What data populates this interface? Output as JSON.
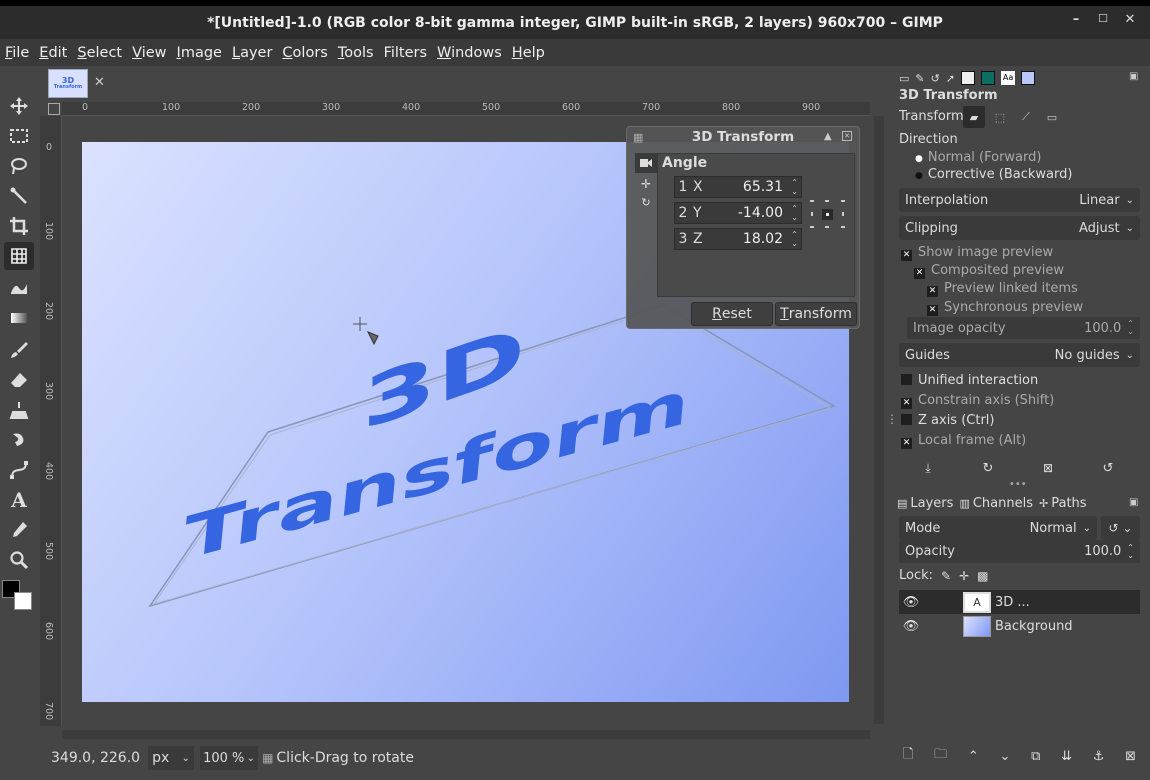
{
  "titlebar": {
    "title": "*[Untitled]-1.0 (RGB color 8-bit gamma integer, GIMP built-in sRGB, 2 layers) 960x700 – GIMP",
    "minimize": "–",
    "maximize": "☐",
    "close": "✕"
  },
  "menus": [
    {
      "label": "File",
      "u": "F",
      "rest": "ile"
    },
    {
      "label": "Edit",
      "u": "E",
      "rest": "dit"
    },
    {
      "label": "Select",
      "u": "S",
      "rest": "elect"
    },
    {
      "label": "View",
      "u": "V",
      "rest": "iew"
    },
    {
      "label": "Image",
      "u": "I",
      "rest": "mage"
    },
    {
      "label": "Layer",
      "u": "L",
      "rest": "ayer"
    },
    {
      "label": "Colors",
      "u": "C",
      "rest": "olors"
    },
    {
      "label": "Tools",
      "u": "T",
      "rest": "ools"
    },
    {
      "label": "Filters",
      "u": "",
      "rest": "Filters"
    },
    {
      "label": "Windows",
      "u": "W",
      "rest": "indows"
    },
    {
      "label": "Help",
      "u": "H",
      "rest": "elp"
    }
  ],
  "tab": {
    "thumb_line1": "3D",
    "thumb_line2": "Transform",
    "close": "✕"
  },
  "ruler": {
    "h_labels": [
      "0",
      "100",
      "200",
      "300",
      "400",
      "500",
      "600",
      "700",
      "800",
      "900"
    ],
    "v_labels": [
      "0",
      "100",
      "200",
      "300",
      "400",
      "500",
      "600",
      "700"
    ]
  },
  "canvas_text": {
    "line1": "3D",
    "line2": "Transform"
  },
  "overlay": {
    "title": "3D Transform",
    "section": "Angle",
    "rows": [
      {
        "num": "1",
        "axis": "X",
        "value": "65.31"
      },
      {
        "num": "2",
        "axis": "Y",
        "value": "-14.00"
      },
      {
        "num": "3",
        "axis": "Z",
        "value": "18.02"
      }
    ],
    "reset_label": "Reset",
    "reset_u": "R",
    "reset_rest": "eset",
    "transform_label": "Transform",
    "transform_u": "T",
    "transform_rest": "ransform"
  },
  "status": {
    "coords": "349.0, 226.0",
    "unit": "px",
    "zoom": "100 %",
    "message": "Click-Drag to rotate"
  },
  "tool_options": {
    "title": "3D Transform",
    "transform_label": "Transform:",
    "direction_label": "Direction",
    "direction_normal": "Normal (Forward)",
    "direction_corrective": "Corrective (Backward)",
    "interpolation_label": "Interpolation",
    "interpolation_value": "Linear",
    "clipping_label": "Clipping",
    "clipping_value": "Adjust",
    "show_preview": "Show image preview",
    "composited_preview": "Composited preview",
    "preview_linked": "Preview linked items",
    "sync_preview": "Synchronous preview",
    "opacity_label": "Image opacity",
    "opacity_value": "100.0",
    "guides_label": "Guides",
    "guides_value": "No guides",
    "unified": "Unified interaction",
    "constrain": "Constrain axis (Shift)",
    "zaxis": "Z axis (Ctrl)",
    "localframe": "Local frame (Alt)"
  },
  "layers_panel": {
    "tab_layers": "Layers",
    "tab_channels": "Channels",
    "tab_paths": "Paths",
    "mode_label": "Mode",
    "mode_value": "Normal",
    "opacity_label": "Opacity",
    "opacity_value": "100.0",
    "lock_label": "Lock:",
    "layers": [
      {
        "name": "3D ..."
      },
      {
        "name": "Background"
      }
    ]
  }
}
